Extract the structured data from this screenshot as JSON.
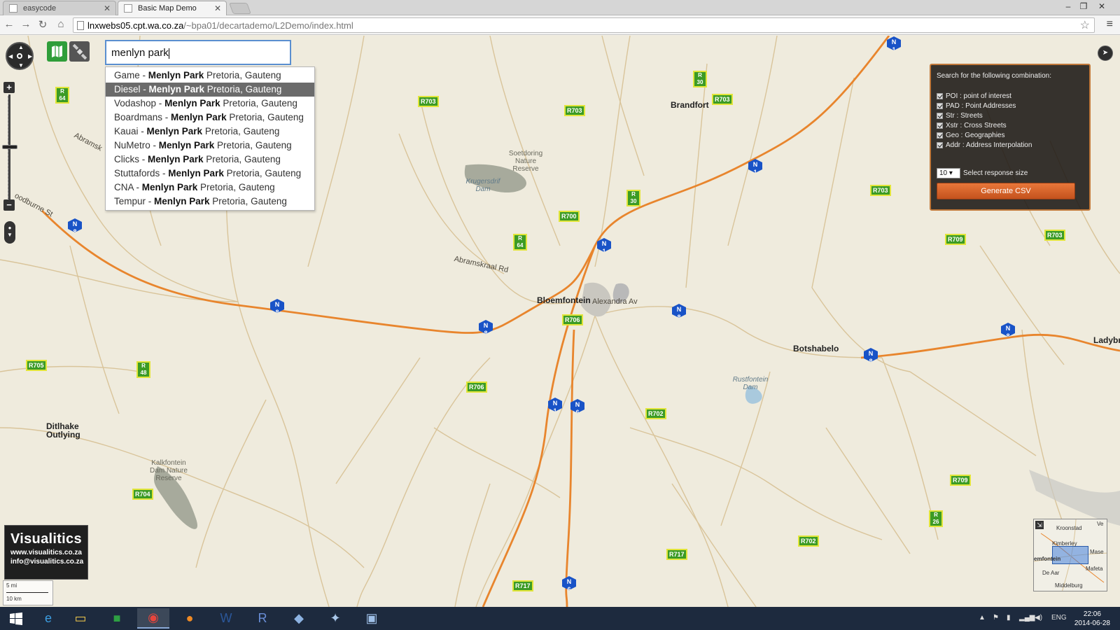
{
  "browser": {
    "tabs": [
      {
        "title": "easycode",
        "active": false
      },
      {
        "title": "Basic Map Demo",
        "active": true
      }
    ],
    "url_host": "lnxwebs05.cpt.wa.co.za",
    "url_path": "/~bpa01/decartademo/L2Demo/index.html"
  },
  "search": {
    "query": "menlyn park",
    "suggestions": [
      {
        "prefix": "Game - ",
        "match": "Menlyn Park",
        "suffix": " Pretoria, Gauteng",
        "selected": false
      },
      {
        "prefix": "Diesel - ",
        "match": "Menlyn Park",
        "suffix": " Pretoria, Gauteng",
        "selected": true
      },
      {
        "prefix": "Vodashop - ",
        "match": "Menlyn Park",
        "suffix": " Pretoria, Gauteng",
        "selected": false
      },
      {
        "prefix": "Boardmans - ",
        "match": "Menlyn Park",
        "suffix": " Pretoria, Gauteng",
        "selected": false
      },
      {
        "prefix": "Kauai - ",
        "match": "Menlyn Park",
        "suffix": " Pretoria, Gauteng",
        "selected": false
      },
      {
        "prefix": "NuMetro - ",
        "match": "Menlyn Park",
        "suffix": " Pretoria, Gauteng",
        "selected": false
      },
      {
        "prefix": "Clicks - ",
        "match": "Menlyn Park",
        "suffix": " Pretoria, Gauteng",
        "selected": false
      },
      {
        "prefix": "Stuttafords - ",
        "match": "Menlyn Park",
        "suffix": " Pretoria, Gauteng",
        "selected": false
      },
      {
        "prefix": "CNA - ",
        "match": "Menlyn Park",
        "suffix": " Pretoria, Gauteng",
        "selected": false
      },
      {
        "prefix": "Tempur - ",
        "match": "Menlyn Park",
        "suffix": " Pretoria, Gauteng",
        "selected": false
      }
    ]
  },
  "panel": {
    "header": "Search for the following combination:",
    "options": [
      {
        "label": "POI : point of interest",
        "checked": true
      },
      {
        "label": "PAD : Point Addresses",
        "checked": true
      },
      {
        "label": "Str : Streets",
        "checked": true
      },
      {
        "label": "Xstr : Cross Streets",
        "checked": true
      },
      {
        "label": "Geo : Geographies",
        "checked": true
      },
      {
        "label": "Addr : Address Interpolation",
        "checked": true
      }
    ],
    "response_size_value": "10",
    "response_size_label": "Select response size",
    "generate_label": "Generate CSV"
  },
  "logo": {
    "name": "Visualitics",
    "website": "www.visualitics.co.za",
    "email": "info@visualitics.co.za"
  },
  "scale": {
    "miles": "5 mi",
    "km": "10 km"
  },
  "map": {
    "towns": [
      "Bloemfontein",
      "Brandfort",
      "Botshabelo",
      "Ladybr",
      "Ditlhake Outlying"
    ],
    "parks": [
      "Soetdoring Nature Reserve",
      "Kalkfontein Dam Nature Reserve"
    ],
    "waters": [
      "Krugersdrif Dam",
      "Rustfontein Dam"
    ],
    "streets": [
      "Abramskraal Rd",
      "Alexandra Av",
      "Abramsk",
      "oodburne St"
    ]
  },
  "minimap": {
    "labels": [
      "Kroonstad",
      "Kimberley",
      "emfontein",
      "De Aar",
      "Middelburg",
      "Mase",
      "Mafeta",
      "Ve"
    ]
  },
  "taskbar": {
    "lang": "ENG",
    "time": "22:06",
    "date": "2014-06-28"
  },
  "colors": {
    "accent_orange": "#e9773a",
    "panel_bg": "#1c1814",
    "selected_suggestion": "#6b6b6b",
    "route_green": "#3c9b25",
    "route_blue": "#1953c7"
  }
}
